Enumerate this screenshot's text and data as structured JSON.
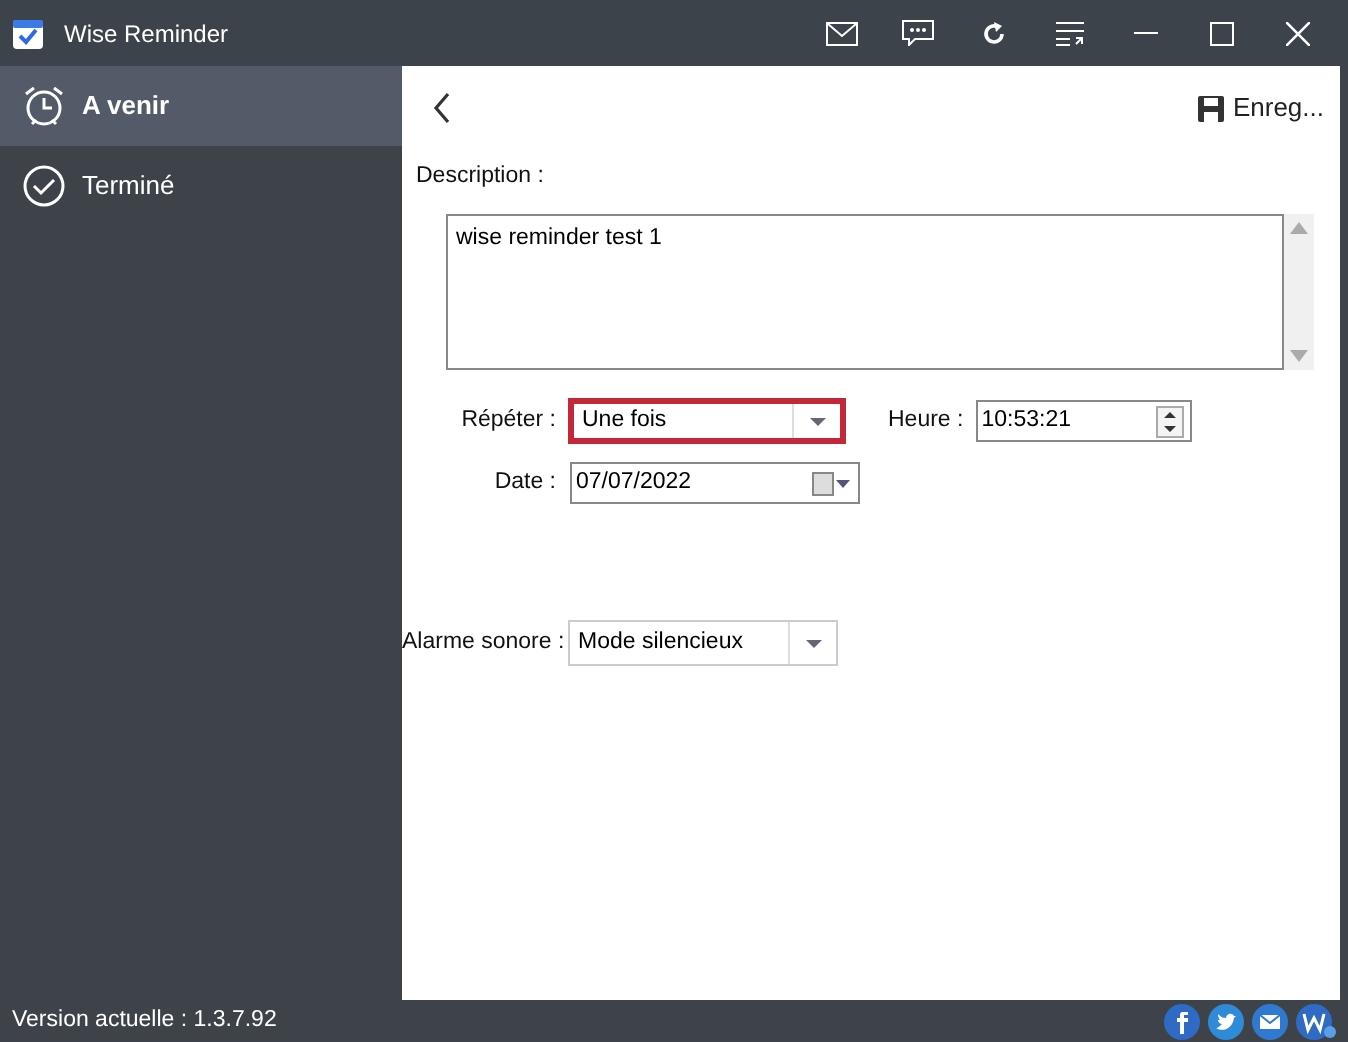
{
  "window": {
    "title": "Wise Reminder"
  },
  "sidebar": {
    "items": [
      {
        "label": "A venir",
        "selected": true
      },
      {
        "label": "Terminé",
        "selected": false
      }
    ]
  },
  "toolbar": {
    "save": "Enreg..."
  },
  "form": {
    "description": {
      "label": "Description :",
      "value": "wise reminder test 1"
    },
    "repeat": {
      "label": "Répéter :",
      "value": "Une fois",
      "focused": true
    },
    "time": {
      "label": "Heure :",
      "value": "10:53:21"
    },
    "date": {
      "label": "Date :",
      "value": "07/07/2022"
    },
    "alarm": {
      "label": "Alarme sonore :",
      "value": "Mode silencieux"
    }
  },
  "status_bar": {
    "version": "Version actuelle : 1.3.7.92"
  }
}
